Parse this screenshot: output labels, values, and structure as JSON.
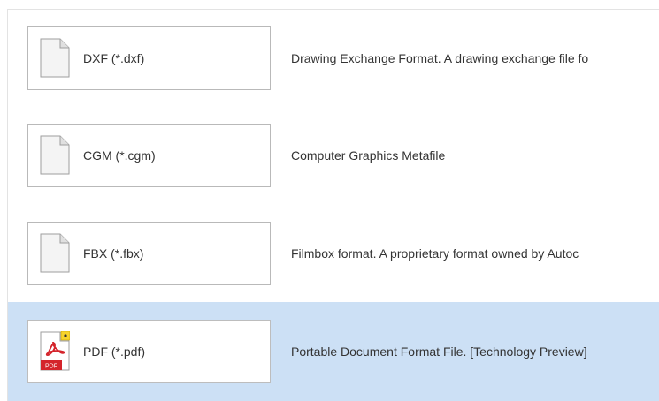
{
  "formats": [
    {
      "label": "DXF (*.dxf)",
      "description": "Drawing Exchange Format.  A drawing exchange file fo",
      "icon": "generic-file-icon",
      "selected": false
    },
    {
      "label": "CGM (*.cgm)",
      "description": "Computer Graphics Metafile",
      "icon": "generic-file-icon",
      "selected": false
    },
    {
      "label": "FBX (*.fbx)",
      "description": "Filmbox format.  A proprietary format owned by Autoc",
      "icon": "generic-file-icon",
      "selected": false
    },
    {
      "label": "PDF (*.pdf)",
      "description": "Portable Document Format File. [Technology Preview]",
      "icon": "pdf-icon",
      "icon_text": "PDF",
      "selected": true
    }
  ],
  "colors": {
    "selected_row": "#cce0f5",
    "pdf_red": "#d4242b",
    "badge_yellow": "#f7d32b"
  }
}
